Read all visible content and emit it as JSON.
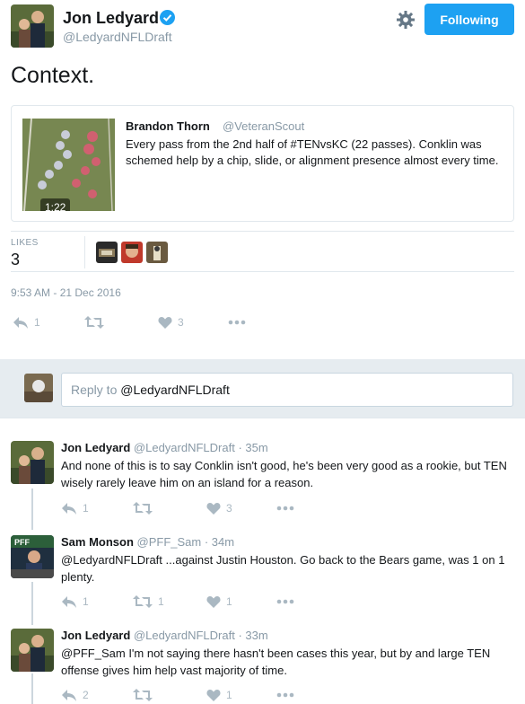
{
  "tweet": {
    "author_name": "Jon Ledyard",
    "author_handle": "@LedyardNFLDraft",
    "follow_label": "Following",
    "text": "Context.",
    "quote": {
      "author_name": "Brandon Thorn",
      "author_handle": "@VeteranScout",
      "text": "Every pass from the 2nd half of #TENvsKC (22 passes). Conklin was schemed help by a chip, slide, or alignment presence almost every time.",
      "video_duration": "1:22"
    },
    "likes_label": "LIKES",
    "likes_count": "3",
    "timestamp": "9:53 AM - 21 Dec 2016",
    "actions": {
      "reply_count": "1",
      "retweet_count": "",
      "like_count": "3"
    }
  },
  "reply_box": {
    "prefix": "Reply to ",
    "target": "@LedyardNFLDraft"
  },
  "replies": [
    {
      "name": "Jon Ledyard",
      "meta": "@LedyardNFLDraft · 35m",
      "text": "And none of this is to say Conklin isn't good, he's been very good as a rookie, but TEN wisely rarely leave him on an island for a reason.",
      "reply_count": "1",
      "retweet_count": "",
      "like_count": "3"
    },
    {
      "name": "Sam Monson",
      "meta": "@PFF_Sam · 34m",
      "text": "@LedyardNFLDraft ...against Justin Houston. Go back to the Bears game, was 1 on 1 plenty.",
      "reply_count": "1",
      "retweet_count": "1",
      "like_count": "1"
    },
    {
      "name": "Jon Ledyard",
      "meta": "@LedyardNFLDraft · 33m",
      "text": "@PFF_Sam I'm not saying there hasn't been cases this year, but by and large TEN offense gives him help vast majority of time.",
      "reply_count": "2",
      "retweet_count": "",
      "like_count": "1"
    }
  ],
  "colors": {
    "accent": "#1da1f2",
    "secondary_text": "#8899a6",
    "action_icon": "#aab8c2",
    "reply_bg": "#e6ecf0"
  },
  "icons": {
    "verified": "verified-badge-icon",
    "settings": "gear-icon",
    "reply": "reply-icon",
    "retweet": "retweet-icon",
    "like": "heart-icon",
    "more": "more-dots-icon",
    "play": "video-thumbnail"
  }
}
